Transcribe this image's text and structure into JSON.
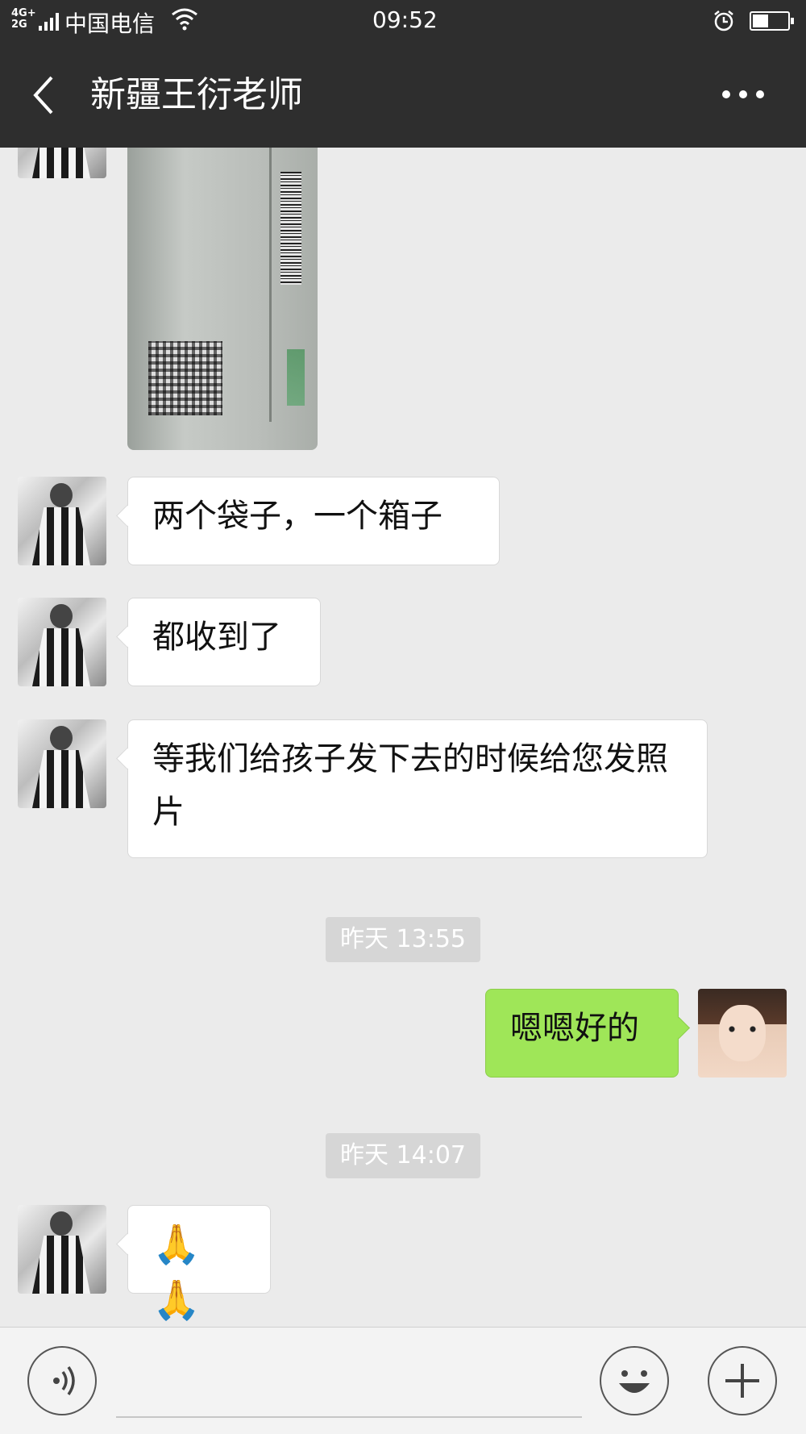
{
  "status_bar": {
    "network": "4G+ 2G",
    "carrier": "中国电信",
    "time": "09:52",
    "battery_level": 0.45
  },
  "nav": {
    "title": "新疆王衍老师"
  },
  "messages": [
    {
      "from": "other",
      "text": "两个袋子，一个箱子"
    },
    {
      "from": "other",
      "text": "都收到了"
    },
    {
      "from": "other",
      "text": "等我们给孩子发下去的时候给您发照片"
    },
    {
      "timestamp": "昨天 13:55"
    },
    {
      "from": "me",
      "text": "嗯嗯好的"
    },
    {
      "timestamp": "昨天 14:07"
    },
    {
      "from": "other",
      "text": "🙏🙏"
    }
  ],
  "icons": {
    "back": "back-arrow-icon",
    "more": "more-dots-icon",
    "voice": "voice-icon",
    "emoji": "emoji-icon",
    "plus": "plus-icon"
  }
}
